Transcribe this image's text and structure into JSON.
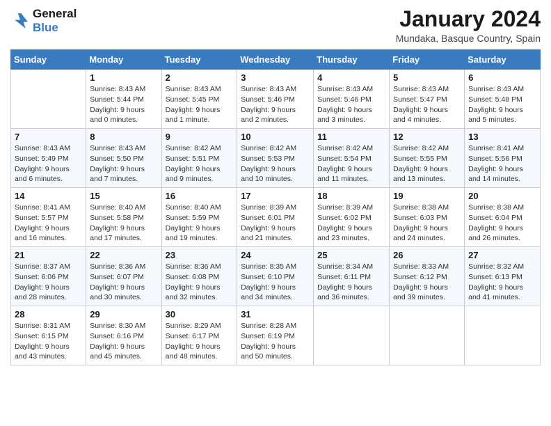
{
  "header": {
    "logo_line1": "General",
    "logo_line2": "Blue",
    "month_title": "January 2024",
    "location": "Mundaka, Basque Country, Spain"
  },
  "days_of_week": [
    "Sunday",
    "Monday",
    "Tuesday",
    "Wednesday",
    "Thursday",
    "Friday",
    "Saturday"
  ],
  "weeks": [
    [
      {
        "day": "",
        "sunrise": "",
        "sunset": "",
        "daylight": ""
      },
      {
        "day": "1",
        "sunrise": "Sunrise: 8:43 AM",
        "sunset": "Sunset: 5:44 PM",
        "daylight": "Daylight: 9 hours and 0 minutes."
      },
      {
        "day": "2",
        "sunrise": "Sunrise: 8:43 AM",
        "sunset": "Sunset: 5:45 PM",
        "daylight": "Daylight: 9 hours and 1 minute."
      },
      {
        "day": "3",
        "sunrise": "Sunrise: 8:43 AM",
        "sunset": "Sunset: 5:46 PM",
        "daylight": "Daylight: 9 hours and 2 minutes."
      },
      {
        "day": "4",
        "sunrise": "Sunrise: 8:43 AM",
        "sunset": "Sunset: 5:46 PM",
        "daylight": "Daylight: 9 hours and 3 minutes."
      },
      {
        "day": "5",
        "sunrise": "Sunrise: 8:43 AM",
        "sunset": "Sunset: 5:47 PM",
        "daylight": "Daylight: 9 hours and 4 minutes."
      },
      {
        "day": "6",
        "sunrise": "Sunrise: 8:43 AM",
        "sunset": "Sunset: 5:48 PM",
        "daylight": "Daylight: 9 hours and 5 minutes."
      }
    ],
    [
      {
        "day": "7",
        "sunrise": "Sunrise: 8:43 AM",
        "sunset": "Sunset: 5:49 PM",
        "daylight": "Daylight: 9 hours and 6 minutes."
      },
      {
        "day": "8",
        "sunrise": "Sunrise: 8:43 AM",
        "sunset": "Sunset: 5:50 PM",
        "daylight": "Daylight: 9 hours and 7 minutes."
      },
      {
        "day": "9",
        "sunrise": "Sunrise: 8:42 AM",
        "sunset": "Sunset: 5:51 PM",
        "daylight": "Daylight: 9 hours and 9 minutes."
      },
      {
        "day": "10",
        "sunrise": "Sunrise: 8:42 AM",
        "sunset": "Sunset: 5:53 PM",
        "daylight": "Daylight: 9 hours and 10 minutes."
      },
      {
        "day": "11",
        "sunrise": "Sunrise: 8:42 AM",
        "sunset": "Sunset: 5:54 PM",
        "daylight": "Daylight: 9 hours and 11 minutes."
      },
      {
        "day": "12",
        "sunrise": "Sunrise: 8:42 AM",
        "sunset": "Sunset: 5:55 PM",
        "daylight": "Daylight: 9 hours and 13 minutes."
      },
      {
        "day": "13",
        "sunrise": "Sunrise: 8:41 AM",
        "sunset": "Sunset: 5:56 PM",
        "daylight": "Daylight: 9 hours and 14 minutes."
      }
    ],
    [
      {
        "day": "14",
        "sunrise": "Sunrise: 8:41 AM",
        "sunset": "Sunset: 5:57 PM",
        "daylight": "Daylight: 9 hours and 16 minutes."
      },
      {
        "day": "15",
        "sunrise": "Sunrise: 8:40 AM",
        "sunset": "Sunset: 5:58 PM",
        "daylight": "Daylight: 9 hours and 17 minutes."
      },
      {
        "day": "16",
        "sunrise": "Sunrise: 8:40 AM",
        "sunset": "Sunset: 5:59 PM",
        "daylight": "Daylight: 9 hours and 19 minutes."
      },
      {
        "day": "17",
        "sunrise": "Sunrise: 8:39 AM",
        "sunset": "Sunset: 6:01 PM",
        "daylight": "Daylight: 9 hours and 21 minutes."
      },
      {
        "day": "18",
        "sunrise": "Sunrise: 8:39 AM",
        "sunset": "Sunset: 6:02 PM",
        "daylight": "Daylight: 9 hours and 23 minutes."
      },
      {
        "day": "19",
        "sunrise": "Sunrise: 8:38 AM",
        "sunset": "Sunset: 6:03 PM",
        "daylight": "Daylight: 9 hours and 24 minutes."
      },
      {
        "day": "20",
        "sunrise": "Sunrise: 8:38 AM",
        "sunset": "Sunset: 6:04 PM",
        "daylight": "Daylight: 9 hours and 26 minutes."
      }
    ],
    [
      {
        "day": "21",
        "sunrise": "Sunrise: 8:37 AM",
        "sunset": "Sunset: 6:06 PM",
        "daylight": "Daylight: 9 hours and 28 minutes."
      },
      {
        "day": "22",
        "sunrise": "Sunrise: 8:36 AM",
        "sunset": "Sunset: 6:07 PM",
        "daylight": "Daylight: 9 hours and 30 minutes."
      },
      {
        "day": "23",
        "sunrise": "Sunrise: 8:36 AM",
        "sunset": "Sunset: 6:08 PM",
        "daylight": "Daylight: 9 hours and 32 minutes."
      },
      {
        "day": "24",
        "sunrise": "Sunrise: 8:35 AM",
        "sunset": "Sunset: 6:10 PM",
        "daylight": "Daylight: 9 hours and 34 minutes."
      },
      {
        "day": "25",
        "sunrise": "Sunrise: 8:34 AM",
        "sunset": "Sunset: 6:11 PM",
        "daylight": "Daylight: 9 hours and 36 minutes."
      },
      {
        "day": "26",
        "sunrise": "Sunrise: 8:33 AM",
        "sunset": "Sunset: 6:12 PM",
        "daylight": "Daylight: 9 hours and 39 minutes."
      },
      {
        "day": "27",
        "sunrise": "Sunrise: 8:32 AM",
        "sunset": "Sunset: 6:13 PM",
        "daylight": "Daylight: 9 hours and 41 minutes."
      }
    ],
    [
      {
        "day": "28",
        "sunrise": "Sunrise: 8:31 AM",
        "sunset": "Sunset: 6:15 PM",
        "daylight": "Daylight: 9 hours and 43 minutes."
      },
      {
        "day": "29",
        "sunrise": "Sunrise: 8:30 AM",
        "sunset": "Sunset: 6:16 PM",
        "daylight": "Daylight: 9 hours and 45 minutes."
      },
      {
        "day": "30",
        "sunrise": "Sunrise: 8:29 AM",
        "sunset": "Sunset: 6:17 PM",
        "daylight": "Daylight: 9 hours and 48 minutes."
      },
      {
        "day": "31",
        "sunrise": "Sunrise: 8:28 AM",
        "sunset": "Sunset: 6:19 PM",
        "daylight": "Daylight: 9 hours and 50 minutes."
      },
      {
        "day": "",
        "sunrise": "",
        "sunset": "",
        "daylight": ""
      },
      {
        "day": "",
        "sunrise": "",
        "sunset": "",
        "daylight": ""
      },
      {
        "day": "",
        "sunrise": "",
        "sunset": "",
        "daylight": ""
      }
    ]
  ]
}
